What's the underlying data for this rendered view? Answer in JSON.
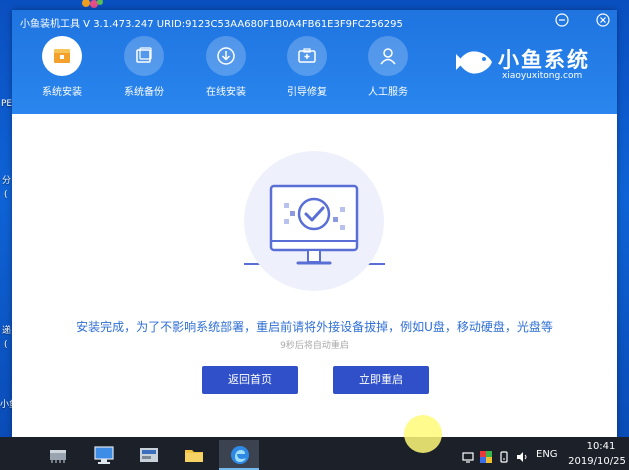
{
  "desktop": {
    "fragments": [
      "PE",
      "分",
      "(",
      "递",
      "(",
      "小鱼"
    ]
  },
  "window": {
    "title": "小鱼装机工具 V 3.1.473.247 URID:9123C53AA680F1B0A4FB61E3F9FC256295",
    "minimize_icon": "minimize-icon",
    "close_icon": "close-icon"
  },
  "nav": {
    "items": [
      {
        "label": "系统安装",
        "icon": "system-install-icon",
        "active": true
      },
      {
        "label": "系统备份",
        "icon": "system-backup-icon",
        "active": false
      },
      {
        "label": "在线安装",
        "icon": "online-install-icon",
        "active": false
      },
      {
        "label": "引导修复",
        "icon": "boot-repair-icon",
        "active": false
      },
      {
        "label": "人工服务",
        "icon": "manual-service-icon",
        "active": false
      }
    ]
  },
  "brand": {
    "name": "小鱼系统",
    "subtitle": "xiaoyuxitong.com"
  },
  "content": {
    "message": "安装完成，为了不影响系统部署，重启前请将外接设备拔掉，例如U盘，移动硬盘，光盘等",
    "countdown": "9秒后将自动重启",
    "buttons": {
      "home": "返回首页",
      "restart": "立即重启"
    }
  },
  "taskbar": {
    "apps": [
      "chip-icon",
      "computer-icon",
      "disk-tool-icon",
      "folder-icon",
      "edge-icon"
    ],
    "tray_icons": [
      "network-icon",
      "color-icon",
      "disk-icon",
      "speaker-icon"
    ],
    "language": "ENG",
    "time": "10:41",
    "date": "2019/10/25"
  },
  "colors": {
    "accent": "#2a86ee",
    "button": "#2f50c8",
    "message": "#2f6fd6",
    "taskbar": "#1b2029"
  }
}
